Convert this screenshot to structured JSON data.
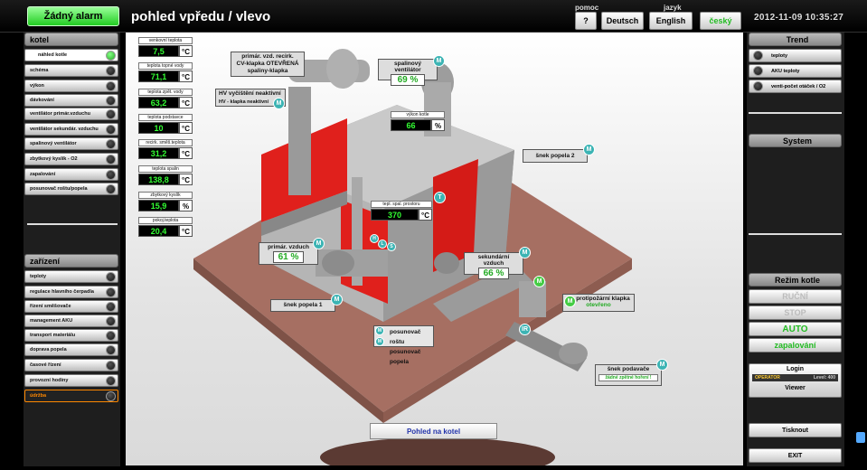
{
  "header": {
    "alarm": "Žádný alarm",
    "title": "pohled vpředu / vlevo",
    "help_label": "pomoc",
    "help_btn": "?",
    "lang_label": "jazyk",
    "lang_de": "Deutsch",
    "lang_en": "English",
    "lang_cz": "český",
    "datetime": "2012-11-09 10:35:27"
  },
  "left": {
    "kotel_header": "kotel",
    "kotel_items": [
      "náhled kotle",
      "schéma",
      "výkon",
      "dávkování",
      "ventilátor primár.vzduchu",
      "ventilátor sekundár. vzduchu",
      "spalinový ventilátor",
      "zbytkový kyslík - O2",
      "zapalování",
      "posunovač roštu/popela"
    ],
    "zarizeni_header": "zařízení",
    "zarizeni_items": [
      "teploty",
      "regulace hlavního čerpadla",
      "řízení směšovače",
      "management AKU",
      "transport materiálu",
      "doprava popela",
      "časové řízení",
      "provozní hodiny",
      "údržba"
    ]
  },
  "sensors": [
    {
      "label": "venkovní teplota",
      "value": "7,5",
      "unit": "°C"
    },
    {
      "label": "teplota topné vody",
      "value": "71,1",
      "unit": "°C"
    },
    {
      "label": "teplota zpět. vody",
      "value": "63,2",
      "unit": "°C"
    },
    {
      "label": "teplota podstavce",
      "value": "10",
      "unit": "°C"
    },
    {
      "label": "recirk. směš.teplota",
      "value": "31,2",
      "unit": "°C"
    },
    {
      "label": "teplota spalin",
      "value": "138,8",
      "unit": "°C"
    },
    {
      "label": "zbytkový kyslík",
      "value": "15,9",
      "unit": "%"
    },
    {
      "label": "pokoj.teplota",
      "value": "20,4",
      "unit": "°C"
    }
  ],
  "scene": {
    "recirc": "primár. vzd. recirk.\nCV-klapka OTEVŘENÁ\nspaliny-klapka",
    "hv_title": "HV vyčištění neaktivní",
    "hv_sub": "HV - klapka neaktivní",
    "flue_fan": "spalinový ventilátor",
    "flue_fan_val": "69 %",
    "power_label": "výkon kotle",
    "power_val": "66",
    "power_unit": "%",
    "ash2": "šnek popela 2",
    "comb_label": "tepl. spal. prostoru",
    "comb_val": "370",
    "comb_unit": "°C",
    "primary": "primár. vzduch",
    "primary_val": "61 %",
    "secondary": "sekundární vzduch",
    "secondary_val": "66 %",
    "ash1": "šnek popela 1",
    "fire_flap": "protipožární klapka",
    "fire_flap_state": "otevřeno",
    "grate": "posunovač roštu",
    "ash_pusher": "posunovač popela",
    "feeder": "šnek podavače",
    "feeder_state": "žádné zpětné hoření !",
    "view_btn": "Pohled na kotel",
    "m": "M",
    "t": "T",
    "ir": "IR",
    "h": "H",
    "l": "L",
    "s": "S"
  },
  "right": {
    "trend_header": "Trend",
    "trend_items": [
      "teploty",
      "AKU teploty",
      "venti-počet otáček / O2"
    ],
    "system": "System",
    "mode_header": "Režim kotle",
    "mode_manual": "RUČNÍ",
    "mode_stop": "STOP",
    "mode_auto": "AUTO",
    "mode_ignite": "zapalování",
    "login": "Login",
    "operator": "OPERATOR",
    "level": "Level: 400",
    "viewer": "Viewer",
    "print": "Tisknout",
    "exit": "EXIT"
  }
}
